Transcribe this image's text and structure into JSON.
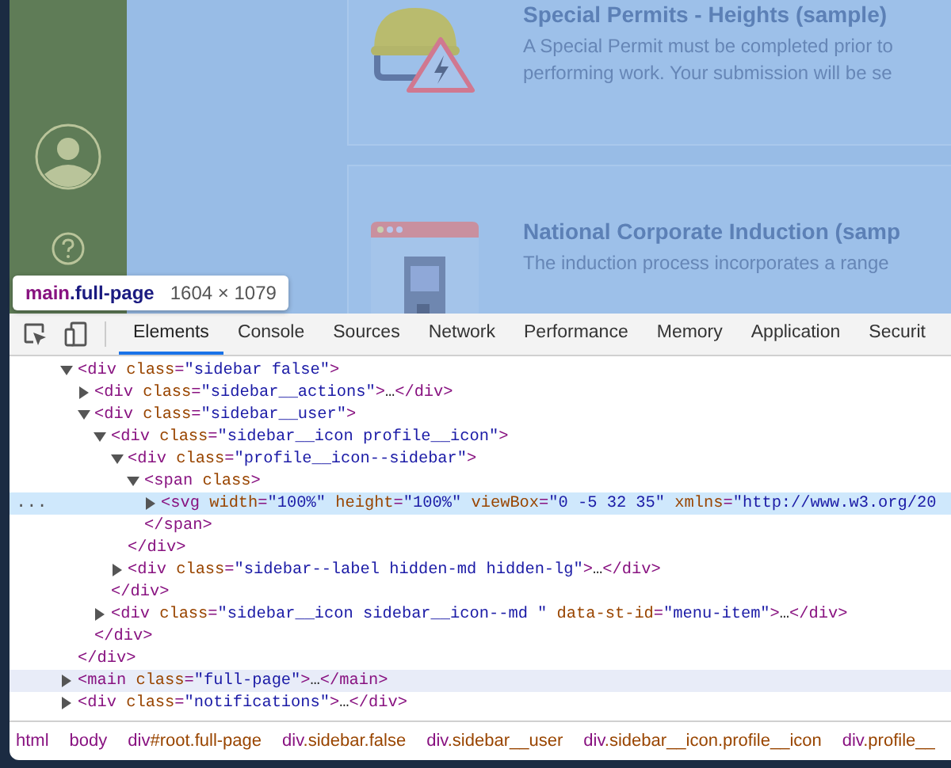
{
  "page": {
    "cards": [
      {
        "kind": "hard-hat-warning",
        "title": "Special Permits - Heights (sample)",
        "description_lines": [
          "A Special Permit must be completed prior to",
          "performing work. Your submission will be se"
        ]
      },
      {
        "kind": "building-window",
        "title": "National Corporate Induction (samp",
        "description_lines": [
          "The induction process incorporates a range"
        ]
      }
    ]
  },
  "inspect_tooltip": {
    "tag": "main",
    "classes": ".full-page",
    "size": "1604 × 1079"
  },
  "devtools": {
    "tabs": [
      {
        "label": "Elements",
        "selected": true
      },
      {
        "label": "Console",
        "selected": false
      },
      {
        "label": "Sources",
        "selected": false
      },
      {
        "label": "Network",
        "selected": false
      },
      {
        "label": "Performance",
        "selected": false
      },
      {
        "label": "Memory",
        "selected": false
      },
      {
        "label": "Application",
        "selected": false
      },
      {
        "label": "Securit",
        "selected": false
      }
    ],
    "selected_gutter": "...",
    "dom_tree": [
      {
        "open": "<div class=\"sidebar false\">",
        "expanded": true,
        "selected": false,
        "hovered": false,
        "close": "</div>",
        "children": [
          {
            "open": "<div class=\"sidebar__actions\">…</div>",
            "expanded": false,
            "selected": false,
            "hovered": false
          },
          {
            "open": "<div class=\"sidebar__user\">",
            "expanded": true,
            "selected": false,
            "hovered": false,
            "close": "</div>",
            "children": [
              {
                "open": "<div class=\"sidebar__icon profile__icon\">",
                "expanded": true,
                "selected": false,
                "hovered": false,
                "close": "</div>",
                "children": [
                  {
                    "open": "<div class=\"profile__icon--sidebar\">",
                    "expanded": true,
                    "selected": false,
                    "hovered": false,
                    "close": "</div>",
                    "children": [
                      {
                        "open": "<span class>",
                        "expanded": true,
                        "selected": false,
                        "hovered": false,
                        "close": "</span>",
                        "children": [
                          {
                            "open": "<svg width=\"100%\" height=\"100%\" viewBox=\"0 -5 32 35\" xmlns=\"http://www.w3.org/20",
                            "expanded": false,
                            "selected": true,
                            "hovered": false
                          }
                        ]
                      }
                    ]
                  },
                  {
                    "open": "<div class=\"sidebar--label hidden-md hidden-lg\">…</div>",
                    "expanded": false,
                    "selected": false,
                    "hovered": false
                  }
                ]
              },
              {
                "open": "<div class=\"sidebar__icon sidebar__icon--md \" data-st-id=\"menu-item\">…</div>",
                "expanded": false,
                "selected": false,
                "hovered": false
              }
            ]
          }
        ]
      },
      {
        "open": "<main class=\"full-page\">…</main>",
        "expanded": false,
        "selected": false,
        "hovered": true
      },
      {
        "open": "<div class=\"notifications\">…</div>",
        "expanded": false,
        "selected": false,
        "hovered": false
      }
    ],
    "breadcrumbs": [
      "html",
      "body",
      "div#root.full-page",
      "div.sidebar.false",
      "div.sidebar__user",
      "div.sidebar__icon.profile__icon",
      "div.profile__"
    ]
  }
}
